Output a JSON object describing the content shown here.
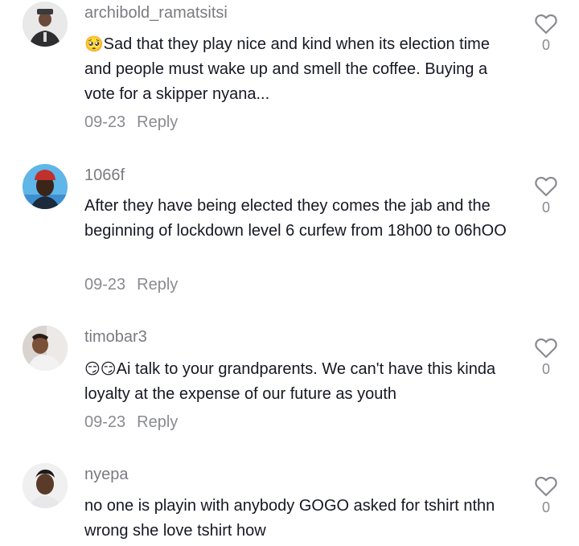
{
  "comments": [
    {
      "username": "archibold_ramatsitsi",
      "emoji": "🥺",
      "text": "Sad that they play nice and kind when its election time and people must wake up and smell the coffee. Buying a vote for a skipper nyana...",
      "date": "09-23",
      "reply_label": "Reply",
      "likes": "0"
    },
    {
      "username": "1066f",
      "emoji": "",
      "text": "After they have being elected they comes the jab and the beginning of lockdown level 6 curfew from 18h00 to 06hOO",
      "date": "09-23",
      "reply_label": "Reply",
      "likes": "0"
    },
    {
      "username": "timobar3",
      "emoji": "😏😏",
      "text": "Ai talk to your grandparents. We can't have this kinda loyalty at the expense of our future as youth",
      "date": "09-23",
      "reply_label": "Reply",
      "likes": "0"
    },
    {
      "username": "nyepa",
      "emoji": "",
      "text": "no one is playin with anybody GOGO asked for tshirt nthn wrong she love tshirt how",
      "date": "",
      "reply_label": "",
      "likes": "0"
    }
  ],
  "icons": {
    "like": "heart-outline-icon",
    "avatar": "user-avatar"
  },
  "colors": {
    "text": "#161823",
    "secondary": "#8a8b91",
    "background": "#ffffff"
  }
}
